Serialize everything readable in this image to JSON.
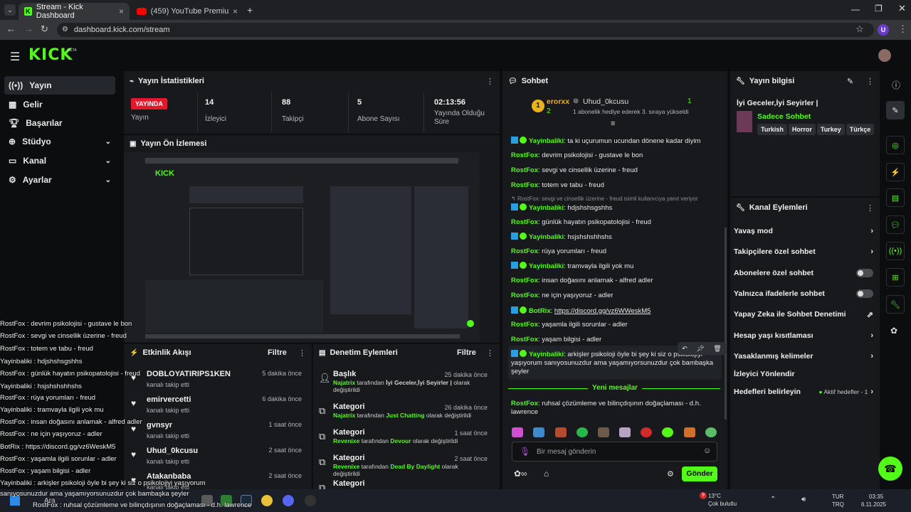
{
  "browser": {
    "tabs": [
      {
        "label": "Stream - Kick Dashboard"
      },
      {
        "label": "(459) YouTube Premium - YouT"
      }
    ],
    "url": "dashboard.kick.com/stream",
    "profile_initial": "U"
  },
  "kick": {
    "logo": "KICK",
    "beta": "BETA"
  },
  "sidebar": {
    "items": [
      {
        "label": "Yayın",
        "icon": "broadcast-icon"
      },
      {
        "label": "Gelir",
        "icon": "revenue-icon"
      },
      {
        "label": "Başarılar",
        "icon": "trophy-icon"
      },
      {
        "label": "Stüdyo",
        "icon": "studio-icon"
      },
      {
        "label": "Kanal",
        "icon": "channel-icon"
      },
      {
        "label": "Ayarlar",
        "icon": "settings-icon"
      }
    ]
  },
  "stats": {
    "title": "Yayın İstatistikleri",
    "live_label": "YAYINDA",
    "live_sub": "Yayın",
    "viewers": "14",
    "viewers_label": "İzleyici",
    "followers": "88",
    "followers_label": "Takipçi",
    "subs": "5",
    "subs_label": "Abone Sayısı",
    "uptime": "02:13:56",
    "uptime_label": "Yayında Olduğu Süre"
  },
  "preview": {
    "title": "Yayın Ön İzlemesi"
  },
  "activity": {
    "title": "Etkinlik Akışı",
    "filter": "Filtre",
    "items": [
      {
        "name": "DOBLOYATIRIPS1KEN",
        "sub": "kanalı takip etti",
        "time": "5 dakika önce"
      },
      {
        "name": "emirvercetti",
        "sub": "kanalı takip etti",
        "time": "6 dakika önce"
      },
      {
        "name": "gvnsyr",
        "sub": "kanalı takip etti",
        "time": "1 saat önce"
      },
      {
        "name": "Uhud_0kcusu",
        "sub": "kanalı takip etti",
        "time": "2 saat önce"
      },
      {
        "name": "Atakanbaba",
        "sub": "kanalı takip etti",
        "time": "2 saat önce"
      }
    ]
  },
  "moderation": {
    "title": "Denetim Eylemleri",
    "filter": "Filtre",
    "items": [
      {
        "title": "Başlık",
        "time": "25 dakika önce",
        "user": "Najatrix",
        "mid": " tarafından ",
        "target": "İyi Geceler,İyi Seyirler | ",
        "tail": "olarak değiştirildi"
      },
      {
        "title": "Kategori",
        "time": "26 dakika önce",
        "user": "Najatrix",
        "mid": " tarafından ",
        "target": "Just Chatting",
        "tail": " olarak değiştirildi"
      },
      {
        "title": "Kategori",
        "time": "1 saat önce",
        "user": "Revenixe",
        "mid": " tarafından ",
        "target": "Devour",
        "tail": " olarak değiştirildi"
      },
      {
        "title": "Kategori",
        "time": "2 saat önce",
        "user": "Revenixe",
        "mid": " tarafından ",
        "target": "Dead By Daylight",
        "tail": " olarak değiştirildi"
      },
      {
        "title": "Kategori",
        "time": "",
        "user": "",
        "mid": "",
        "target": "",
        "tail": ""
      }
    ]
  },
  "chat": {
    "title": "Sohbet",
    "top_gifter": "erorxx",
    "top_gifter_count": "2",
    "gift_user": "Uhud_0kcusu",
    "gift_count": "1",
    "gift_text": "1 abonelik hediye ederek 3. sıraya yükseldi",
    "messages": [
      {
        "user": "Yayinbaliki",
        "text": ": ta ki uçurumun ucundan dönene kadar diyim",
        "badge": true
      },
      {
        "user": "RostFox",
        "text": ": devrim psikolojisi - gustave le bon",
        "badge": false
      },
      {
        "user": "RostFox",
        "text": ": sevgi ve cinsellik üzerine - freud",
        "badge": false
      },
      {
        "user": "RostFox",
        "text": ": totem ve tabu - freud",
        "badge": false
      },
      {
        "user": "Yayinbaliki",
        "text": ": hdjshshsgshhs",
        "badge": true
      },
      {
        "user": "RostFox",
        "text": ": günlük hayatın psikopatolojisi - freud",
        "badge": false
      },
      {
        "user": "Yayinbaliki",
        "text": ": hsjshshshhshs",
        "badge": true
      },
      {
        "user": "RostFox",
        "text": ": rüya yorumları - freud",
        "badge": false
      },
      {
        "user": "Yayinbaliki",
        "text": ": tramvayla ilgili yok mu",
        "badge": true
      },
      {
        "user": "RostFox",
        "text": ": insan doğasını anlamak - alfred adler",
        "badge": false
      },
      {
        "user": "RostFox",
        "text": ": ne için yaşıyoruz - adler",
        "badge": false
      },
      {
        "user": "BotRix",
        "text": "https://discord.gg/vz6WWeskM5",
        "badge": true
      },
      {
        "user": "RostFox",
        "text": ": yaşamla ilgili sorunlar - adler",
        "badge": false
      },
      {
        "user": "RostFox",
        "text": ": yaşam bilgisi - adler",
        "badge": false
      },
      {
        "user": "Yayinbaliki",
        "text": ": arkişler psikoloji öyle bi şey ki siz o psikolojiyi yaşıyorum sanıyosunuzdur ama yaşamıyorsunuzdur çok bambaşka şeyler",
        "badge": true
      }
    ],
    "reply_hint": "RostFox: sevgi ve cinsellik üzerine - freud isimli kullanıcıya yanıt veriyor",
    "new_messages": "Yeni mesajlar",
    "last_msg_user": "RostFox",
    "last_msg_text": ": ruhsal çözümleme ve bilinçdışının doğaçlaması - d.h. lawrence",
    "input_placeholder": "Bir mesaj gönderin",
    "send": "Gönder"
  },
  "info": {
    "title": "Yayın bilgisi",
    "stream_title": "İyi Geceler,İyi Seyirler |",
    "category": "Sadece Sohbet",
    "tags": [
      "Turkish",
      "Horror",
      "Turkey",
      "Türkçe"
    ]
  },
  "channel_actions": {
    "title": "Kanal Eylemleri",
    "items": [
      {
        "label": "Yavaş mod",
        "kind": "arrow"
      },
      {
        "label": "Takipçilere özel sohbet",
        "kind": "arrow"
      },
      {
        "label": "Abonelere özel sohbet",
        "kind": "toggle"
      },
      {
        "label": "Yalnızca ifadelerle sohbet",
        "kind": "toggle"
      },
      {
        "label": "Yapay Zeka ile Sohbet Denetimi",
        "kind": "ext"
      },
      {
        "label": "Hesap yaşı kısıtlaması",
        "kind": "arrow"
      },
      {
        "label": "Yasaklanmış kelimeler",
        "kind": "arrow"
      },
      {
        "label": "İzleyici Yönlendir",
        "kind": "none"
      },
      {
        "label": "Hedefleri belirleyin",
        "kind": "goal"
      }
    ],
    "goal_status": "Aktif hedefler - 1"
  },
  "overlay": {
    "lines": [
      "RostFox : devrim psikolojisi - gustave le bon",
      "RostFox : sevgi ve cinsellik üzerine - freud",
      "RostFox : totem ve tabu - freud",
      "Yayinbaliki : hdjshshsgshhs",
      "RostFox : günlük hayatın psikopatolojisi - freud",
      "Yayinbaliki : hsjshshshhshs",
      "RostFox : rüya yorumları - freud",
      "Yayinbaliki : tramvayla ilgili yok mu",
      "RostFox : insan doğasını anlamak - alfred adler",
      "RostFox : ne için yaşıyoruz - adler",
      "BotRix : https://discord.gg/vz6WeskM5",
      "RostFox : yaşamla ilgili sorunlar - adler",
      "RostFox : yaşam bilgisi - adler",
      "Yayinbaliki : arkişler psikoloji öyle bi şey ki siz o psikolojiyi yaşıyorum",
      "sanıyosunuzdur ama yaşamıyorsunuzdur çok bambaşka şeyler",
      "RostFox : ruhsal çözümleme ve bilinçdışının doğaçlaması - d.h. lawrence"
    ]
  },
  "taskbar": {
    "search": "Ara",
    "weather_temp": "13°C",
    "weather_text": "Çok bulutlu",
    "weather_badge": "9",
    "lang1": "TUR",
    "lang2": "TRQ",
    "time": "03:35",
    "date": "6.11.2025"
  }
}
